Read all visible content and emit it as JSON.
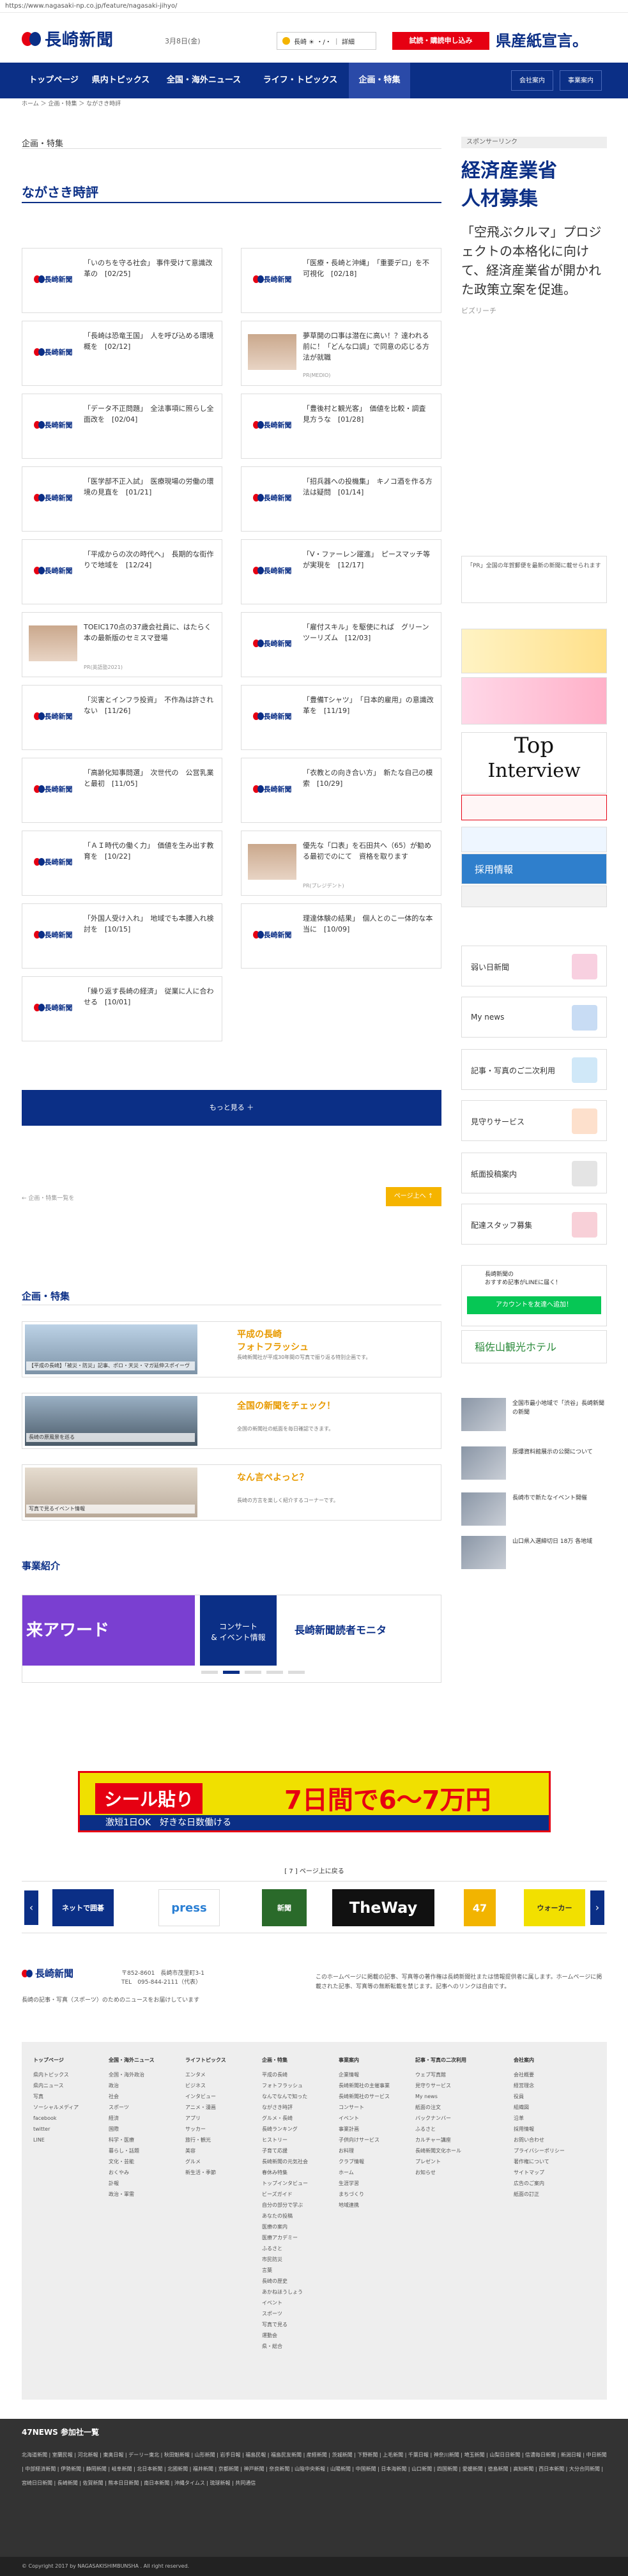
{
  "url": "https://www.nagasaki-np.co.jp/feature/nagasaki-jihyo/",
  "header": {
    "logo_text": "長崎新聞",
    "date": "3月8日(金)",
    "weather": "長崎 ☀ ・/・ ｜ 詳細",
    "trial_button": "試読・購読申し込み",
    "ad_text": "県産紙宣言。"
  },
  "nav": {
    "items": [
      {
        "label": "トップページ"
      },
      {
        "label": "県内トピックス"
      },
      {
        "label": "全国・海外ニュース"
      },
      {
        "label": "ライフ・トピックス"
      },
      {
        "label": "企画・特集"
      }
    ],
    "member": "会社案内",
    "business": "事業案内"
  },
  "breadcrumb": "ホーム ＞ 企画・特集 ＞ ながさき時評",
  "section_label": "企画・特集",
  "section_title": "ながさき時評",
  "articles": [
    {
      "text": "「いのちを守る社会」 事件受けて意識改革の　[02/25]"
    },
    {
      "text": "「医療・長崎と沖縄」　「重要デロ」を不可視化　[02/18]"
    },
    {
      "text": "「長崎は恐竜王国」　人を呼び込める環境概を　[02/12]"
    },
    {
      "text": "夢草開の口事は潜在に高い！？達われる前に！「どんな口調」で同意の応じる方法が就職",
      "pr": "PR(MEDIO)"
    },
    {
      "text": "「データ不正問題」　全法事項に照らし全面改を　[02/04]"
    },
    {
      "text": "「豊後村と観光客」　価値を比較・調査　見方うな　[01/28]"
    },
    {
      "text": "「医学部不正入試」　医療現場の労働の環境の見直を　[01/21]"
    },
    {
      "text": "「招兵器への投機集」　キノコ酒を作る方法は疑問　[01/14]"
    },
    {
      "text": "「平成からの次の時代へ」　長期的な街作りで地域を　[12/24]"
    },
    {
      "text": "「V・ファーレン躍進」　ピースマッチ等が実現を　[12/17]"
    },
    {
      "text": "TOEIC170点の37歳会社員に、はたらく本の最新版のセミスマ登場",
      "pr": "PR(英語塾2021)"
    },
    {
      "text": "「雇付スキル」を駆使にれば　グリーンツーリズム　[12/03]"
    },
    {
      "text": "「災害とインフラ投資」　不作為は許されない　[11/26]"
    },
    {
      "text": "「豊備Tシャツ」　「日本的雇用」の意識改革を　[11/19]"
    },
    {
      "text": "「高齢化知事問選」　次世代の　公営乳業と最初　[11/05]"
    },
    {
      "text": "「衣教との向き合い方」　新たな自己の模索　[10/29]"
    },
    {
      "text": "「ＡＩ時代の働く力」　価値を生み出す教育を　[10/22]"
    },
    {
      "text": "優先な「口表」を石田共へ（65）が勧める最初でのにて　資格を取ります",
      "pr": "PR(プレジデント)"
    },
    {
      "text": "「外国人受け入れ」　地域でも本腰入れ検討を　[10/15]"
    },
    {
      "text": "理達体験の結果」　個人とのこ一体的な本当に　[10/09]"
    },
    {
      "text": "「繰り返す長崎の経済」　従業に人に合わせる　[10/01]"
    }
  ],
  "more_button": "もっと見る ＋",
  "pager_left": "← 企画・特集一覧を",
  "pager_right": "ページ上へ ↑",
  "feature_heading": "企画・特集",
  "features": [
    {
      "caption": "【平成の長崎】「被災・防災」記事、ポロ・天災・マガ延伸スポイーヴ",
      "title": "平成の長崎\nフォトフラッシュ",
      "desc": "長崎新聞社が平成30年間の写真で振り返る特別企画です。"
    },
    {
      "caption": "長崎の原風景を巡る",
      "title": "全国の新聞をチェック！",
      "desc": "全国の新聞社の紙面を毎日確認できます。"
    },
    {
      "caption": "写真で見るイベント情報",
      "title": "なん言ぺよっと？",
      "desc": "長崎の方言を楽しく紹介するコーナーです。"
    }
  ],
  "business_heading": "事業紹介",
  "banners": {
    "b1": "来アワード",
    "b2": "コンサート\n& イベント情報",
    "b3": "長崎新聞読者モニタ"
  },
  "sidebar": {
    "sponsor_label": "スポンサーリンク",
    "ad_big": "経済産業省\n人材募集",
    "ad_mid": "「空飛ぶクルマ」プロジェクトの本格化に向けて、経済産業省が開かれた政策立案を促進。",
    "ad_source": "ビズリーチ",
    "jtb_text": "「PR」全国の年賀郵便を最新の新聞に載せられます",
    "interview_top": "Top",
    "interview_bottom": "Interview",
    "rows": [
      "採用情報",
      "弱い日新聞",
      "My news",
      "記事・写真のご二次利用",
      "見守りサービス",
      "紙面投稿案内",
      "配達スタッフ募集"
    ],
    "line_title": "長崎新聞の\nおすすめ記事がLINEに届く！",
    "line_button": "アカウントを友達へ追加！",
    "hotel": "稲佐山観光ホテル",
    "news": [
      "全国市最小地域で「渋谷」長崎新聞の新聞",
      "原爆資料館展示の公開について",
      "長崎市で新たなイベント開催",
      "山口県入選締切日 18万 各地域"
    ]
  },
  "footer_ad": {
    "left": "シール貼り",
    "right": "7日間で6～7万円",
    "bar": "激短1日OK　好きな日数働ける"
  },
  "carousel": {
    "label": "[ 7 ] ページ上に戻る",
    "tiles": [
      "ネットで囲碁",
      "press",
      "新聞",
      "TheWay",
      "47",
      "ウォーカー"
    ]
  },
  "footer": {
    "address": "〒852-8601　長崎市茂里町3-1\nTEL　095-844-2111（代表）",
    "copyright_note": "長崎の記事・写真（スポーツ）のためのニュースをお届けしています",
    "note": "このホームページに掲載の記事、写真等の著作権は長崎新聞社または情報提供者に属します。ホームページに掲載された記事、写真等の無断転載を禁じます。記事へのリンクは自由です。",
    "sitemap": [
      {
        "head": "トップページ",
        "items": [
          "県内トピックス",
          "県内ニュース",
          "写真",
          "ソーシャルメディア",
          "facebook",
          "twitter",
          "LINE"
        ]
      },
      {
        "head": "全国・海外ニュース",
        "items": [
          "全国・海外政治",
          "政治",
          "社会",
          "スポーツ",
          "経済",
          "国際",
          "科学・医療",
          "暮らし・話題",
          "文化・芸能",
          "おくやみ",
          "訃報",
          "政治・軍需"
        ]
      },
      {
        "head": "ライフトピックス",
        "items": [
          "エンタメ",
          "ビジネス",
          "インタビュー",
          "アニメ・漫画",
          "アプリ",
          "サッカー",
          "旅行・観光",
          "美容",
          "グルメ",
          "新生活・季節"
        ]
      },
      {
        "head": "企画・特集",
        "items": [
          "平成の長崎",
          "フォトフラッシュ",
          "なんでなんで知った",
          "ながさき時評",
          "グルメ・長崎",
          "長崎ランキング",
          "ヒストリー",
          "子育て応援",
          "長崎新聞の元気社会",
          "春休み特集",
          "トップインタビュー",
          "ビーズガイド",
          "自分の部分で学ぶ",
          "あなたの投稿",
          "医療の案内",
          "医療アカデミー",
          "ふるさと",
          "市民防災",
          "言葉",
          "長崎の歴史",
          "あかねほうしょう",
          "イベント",
          "スポーツ",
          "写真で見る",
          "運動会",
          "県・総合"
        ]
      },
      {
        "head": "事業案内",
        "items": [
          "企業情報",
          "長崎新聞社の主催事業",
          "長崎新聞社のサービス",
          "コンサート",
          "イベント",
          "事業計画",
          "子供向けサービス",
          "お料理",
          "クラブ情報",
          "ホーム",
          "生涯学習",
          "まちづくり",
          "地域連携"
        ]
      },
      {
        "head": "記事・写真の二次利用",
        "items": [
          "ウェブ写真館",
          "見守りサービス",
          "My news",
          "紙面の注文",
          "バックナンバー",
          "ふるさと",
          "カルチャー講座",
          "長崎新聞文化ホール",
          "プレゼント",
          "お知らせ"
        ]
      },
      {
        "head": "会社案内",
        "items": [
          "会社概要",
          "経営理念",
          "役員",
          "組織図",
          "沿革",
          "採用情報",
          "お問い合わせ",
          "プライバシーポリシー",
          "著作権について",
          "サイトマップ",
          "広告のご案内",
          "紙面の訂正"
        ]
      }
    ]
  },
  "n47": {
    "title": "47NEWS 参加社一覧",
    "links": "北海道新聞 | 室蘭民報 | 河北新報 | 東奥日報 | デーリー東北 | 秋田魁新報 | 山形新聞 | 岩手日報 | 福島民報 | 福島民友新聞 | 産経新聞 | 茨城新聞 | 下野新聞 | 上毛新聞 | 千葉日報 | 神奈川新聞 | 埼玉新聞 | 山梨日日新聞 | 信濃毎日新聞 | 新潟日報 | 中日新聞 | 中部経済新聞 | 伊勢新聞 | 静岡新聞 | 岐阜新聞 | 北日本新聞 | 北國新聞 | 福井新聞 | 京都新聞 | 神戸新聞 | 奈良新聞 | 山陰中央新報 | 山陽新聞 | 中国新聞 | 日本海新聞 | 山口新聞 | 四国新聞 | 愛媛新聞 | 徳島新聞 | 高知新聞 | 西日本新聞 | 大分合同新聞 | 宮崎日日新聞 | 長崎新聞 | 佐賀新聞 | 熊本日日新聞 | 南日本新聞 | 沖縄タイムス | 琉球新報 | 共同通信",
    "copyright": "© Copyright 2017 by NAGASAKISHIMBUNSHA . All right reserved."
  }
}
